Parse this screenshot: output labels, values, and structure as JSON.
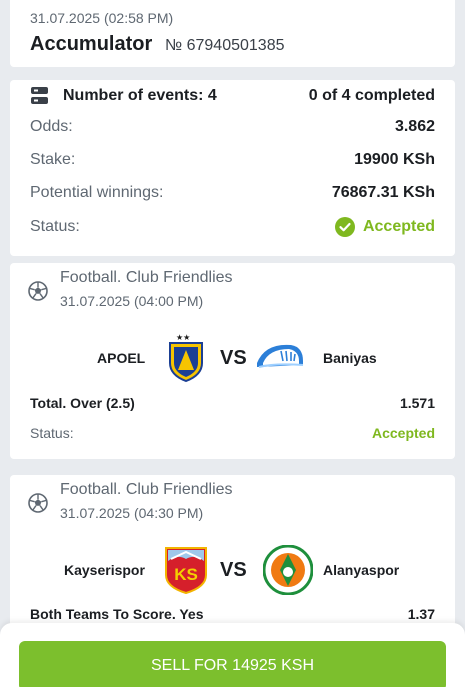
{
  "header": {
    "date": "31.07.2025 (02:58 PM)",
    "title": "Accumulator",
    "bet_number": "№ 67940501385"
  },
  "summary": {
    "events_label": "Number of events: 4",
    "completed": "0 of 4 completed",
    "odds_label": "Odds:",
    "odds_value": "3.862",
    "stake_label": "Stake:",
    "stake_value": "19900 KSh",
    "winnings_label": "Potential winnings:",
    "winnings_value": "76867.31 KSh",
    "status_label": "Status:",
    "status_value": "Accepted"
  },
  "events": [
    {
      "sport": "Football. Club Friendlies",
      "date": "31.07.2025 (04:00 PM)",
      "home": "APOEL",
      "vs": "VS",
      "away": "Baniyas",
      "market": "Total. Over (2.5)",
      "coef": "1.571",
      "status_label": "Status:",
      "status_value": "Accepted"
    },
    {
      "sport": "Football. Club Friendlies",
      "date": "31.07.2025 (04:30 PM)",
      "home": "Kayserispor",
      "vs": "VS",
      "away": "Alanyaspor",
      "market": "Both Teams To Score. Yes",
      "coef": "1.37"
    }
  ],
  "footer": {
    "sell_label": "SELL FOR 14925 KSH"
  },
  "colors": {
    "accent_green": "#7cbf2d",
    "status_green": "#7fb81f",
    "background": "#e8ebef"
  }
}
